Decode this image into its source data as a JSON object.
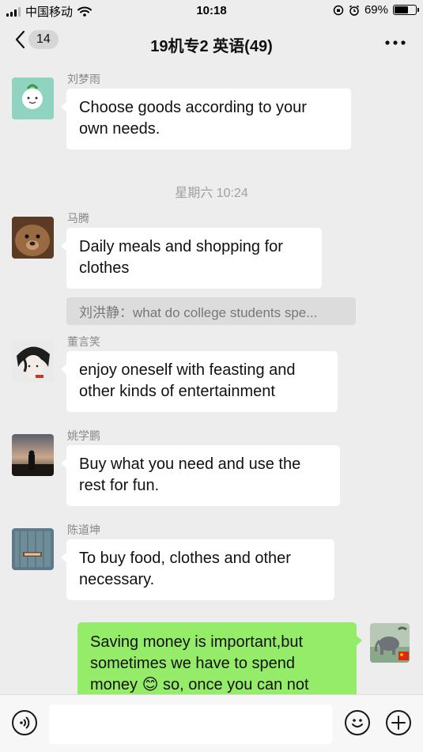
{
  "status_bar": {
    "carrier": "中国移动",
    "time": "10:18",
    "battery_percent_text": "69%",
    "battery_level": 0.69
  },
  "nav": {
    "back_count": "14",
    "title": "19机专2 英语(49)"
  },
  "messages": [
    {
      "sender": "刘梦雨",
      "text": "Choose goods according to your own needs."
    },
    {
      "sender": "马腾",
      "text": "Daily meals and shopping for clothes"
    },
    {
      "sender": "董言笑",
      "text": "enjoy oneself with feasting and other kinds of entertainment"
    },
    {
      "sender": "姚学鹏",
      "text": "Buy what you need and use the rest for fun."
    },
    {
      "sender": "陈道坤",
      "text": "To buy food, clothes and other necessary."
    }
  ],
  "time_divider": "星期六 10:24",
  "quote": "刘洪静：what do college students spe...",
  "own_message": {
    "line1": "Saving money is important,but",
    "line2": "sometimes we have to spend",
    "line3a": "money",
    "line3b": "so, once you can not",
    "emoji": "😊"
  },
  "colors": {
    "background": "#ededed",
    "own_bubble": "#95ec69",
    "other_bubble": "#ffffff"
  }
}
